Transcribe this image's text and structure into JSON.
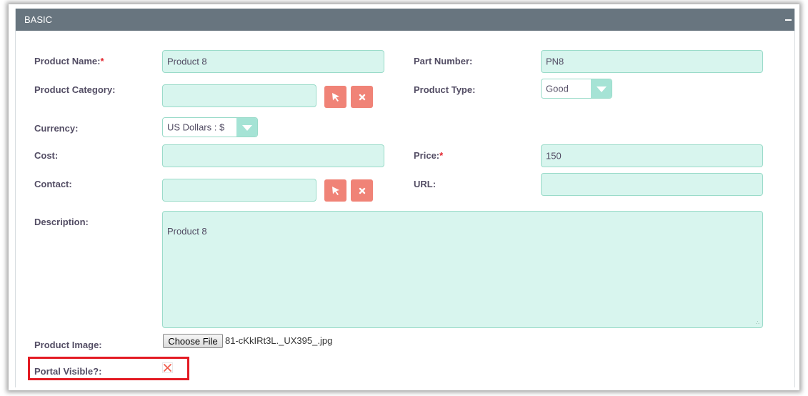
{
  "panel": {
    "title": "BASIC"
  },
  "fields": {
    "product_name": {
      "label": "Product Name:",
      "required": "*",
      "value": "Product 8"
    },
    "part_number": {
      "label": "Part Number:",
      "value": "PN8"
    },
    "product_category": {
      "label": "Product Category:",
      "value": ""
    },
    "product_type": {
      "label": "Product Type:",
      "value": "Good"
    },
    "currency": {
      "label": "Currency:",
      "value": "US Dollars : $"
    },
    "cost": {
      "label": "Cost:",
      "value": ""
    },
    "price": {
      "label": "Price:",
      "required": "*",
      "value": "150"
    },
    "contact": {
      "label": "Contact:",
      "value": ""
    },
    "url": {
      "label": "URL:",
      "value": ""
    },
    "description": {
      "label": "Description:",
      "value": "Product 8"
    },
    "product_image": {
      "label": "Product Image:",
      "button": "Choose File",
      "file": "81-cKkIRt3L._UX395_.jpg"
    },
    "portal_visible": {
      "label": "Portal Visible?:",
      "checked": false
    }
  },
  "colors": {
    "header_bg": "#68757f",
    "field_bg": "#d8f5ee",
    "field_border": "#9adbc9",
    "red_button": "#f08377",
    "highlight": "#e31b23"
  },
  "icons": [
    "select-arrow-icon",
    "clear-x-icon",
    "collapse-minus-icon",
    "unchecked-x-icon"
  ]
}
